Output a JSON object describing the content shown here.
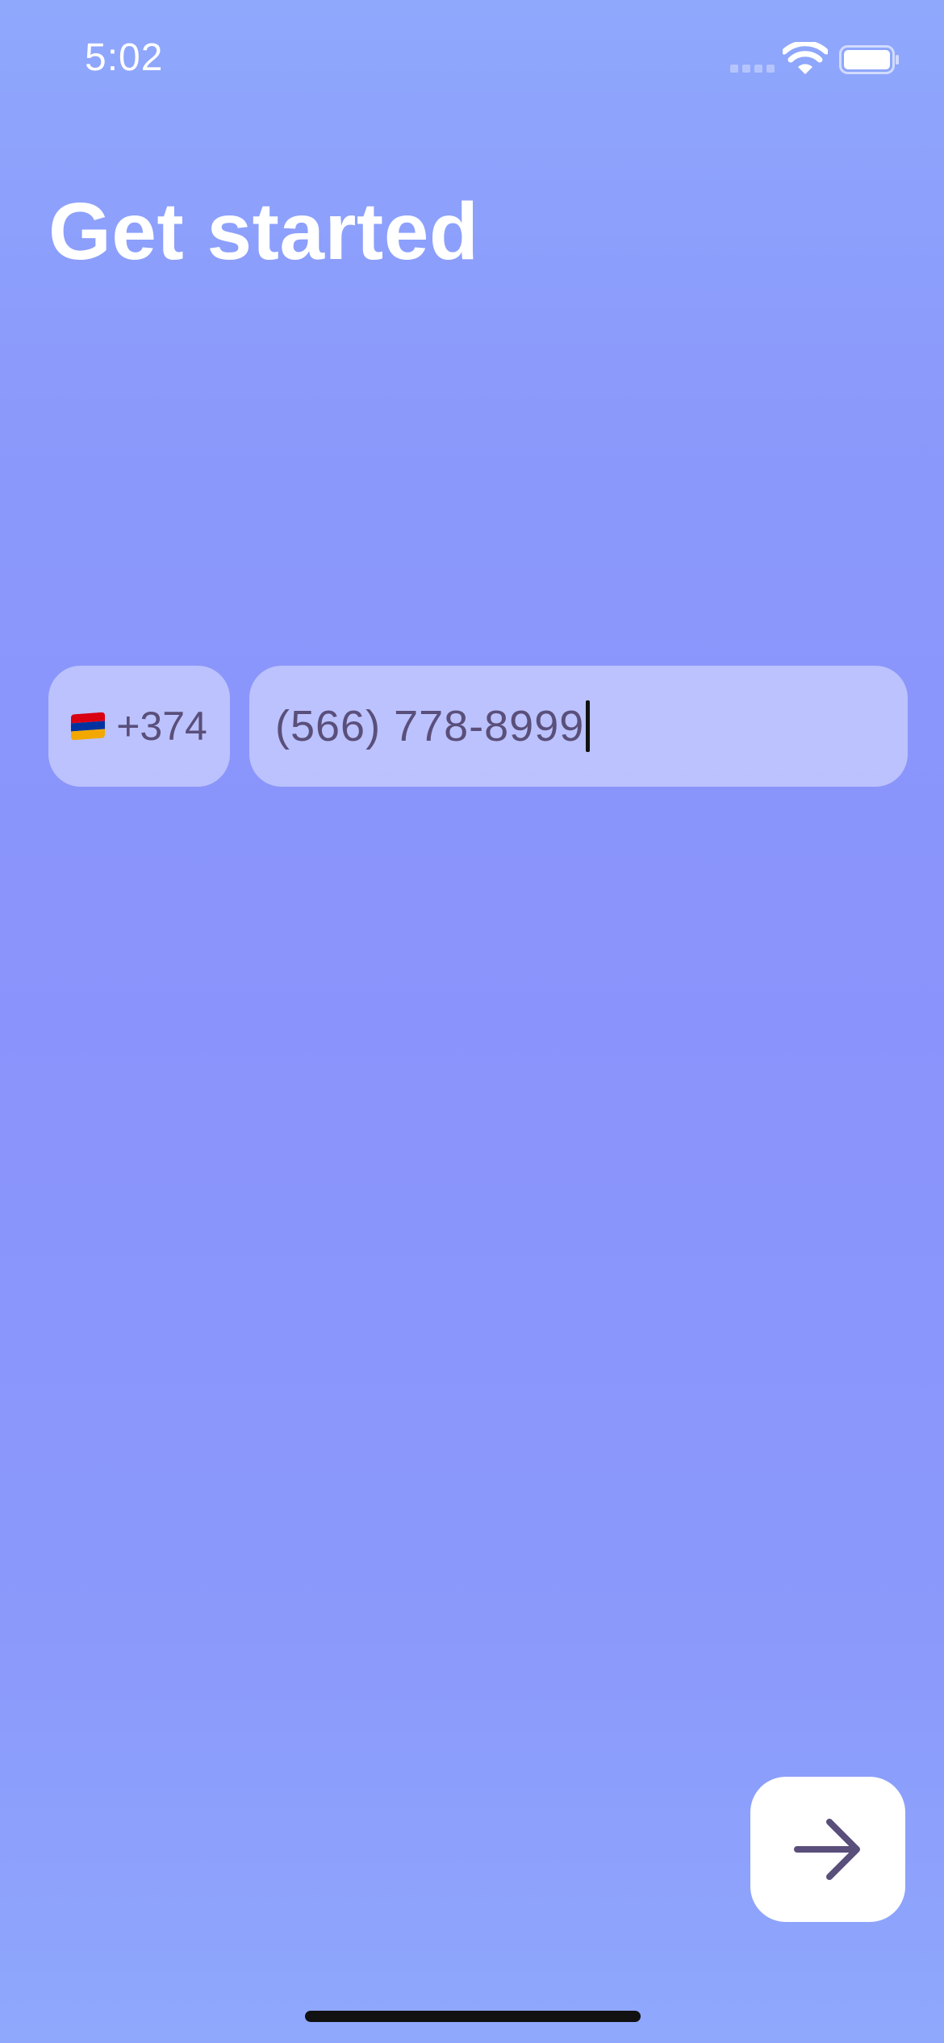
{
  "status_bar": {
    "time": "5:02"
  },
  "header": {
    "title": "Get started"
  },
  "phone_form": {
    "country": {
      "flag_icon": "armenia-flag-icon",
      "code": "+374"
    },
    "phone_number": "(566) 778-8999"
  },
  "next_button": {
    "icon": "arrow-right-icon"
  },
  "colors": {
    "background_top": "#8fa8fc",
    "background_mid": "#8a93fb",
    "field_text": "#5a4f7a",
    "button_bg": "#ffffff",
    "arrow": "#5a4f7a"
  }
}
